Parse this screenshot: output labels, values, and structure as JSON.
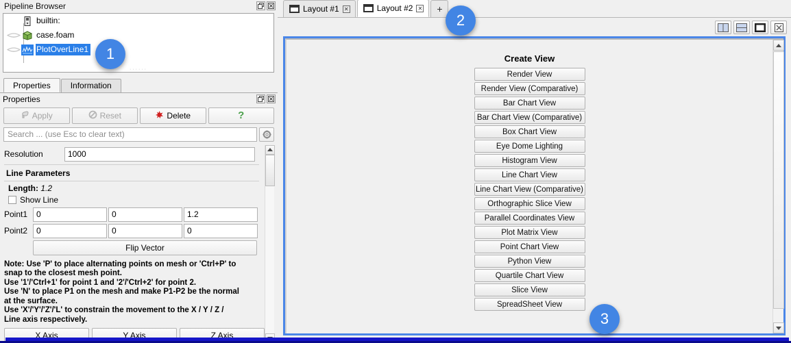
{
  "pipeline": {
    "title": "Pipeline Browser",
    "float_icon": "restore-icon",
    "close_icon": "close-icon",
    "items": [
      {
        "label": "builtin:",
        "icon": "server-icon",
        "selected": false,
        "has_eye": false
      },
      {
        "label": "case.foam",
        "icon": "geometry-box-icon",
        "selected": false,
        "has_eye": true
      },
      {
        "label": "PlotOverLine1",
        "icon": "plot-over-line-icon",
        "selected": true,
        "has_eye": true
      }
    ]
  },
  "properties": {
    "tabs": [
      {
        "label": "Properties",
        "active": true
      },
      {
        "label": "Information",
        "active": false
      }
    ],
    "panel_title": "Properties",
    "actions": [
      {
        "label": "Apply",
        "icon": "apply-icon",
        "disabled": true
      },
      {
        "label": "Reset",
        "icon": "reset-icon",
        "disabled": true
      },
      {
        "label": "Delete",
        "icon": "delete-icon",
        "disabled": false
      },
      {
        "label": "?",
        "icon": "help-icon",
        "disabled": false
      }
    ],
    "search": {
      "placeholder": "Search ... (use Esc to clear text)",
      "value": "",
      "gear_icon": "gear-icon"
    },
    "resolution": {
      "label": "Resolution",
      "value": "1000"
    },
    "line_parameters_title": "Line Parameters",
    "length": {
      "label": "Length:",
      "value": "1.2"
    },
    "show_line": {
      "label": "Show Line",
      "checked": false
    },
    "point1": {
      "label": "Point1",
      "x": "0",
      "y": "0",
      "z": "1.2"
    },
    "point2": {
      "label": "Point2",
      "x": "0",
      "y": "0",
      "z": "0"
    },
    "flip_vector_label": "Flip Vector",
    "note_lines": [
      "Note: Use 'P' to place alternating points on mesh or 'Ctrl+P' to",
      "snap to the closest mesh point.",
      "Use '1'/'Ctrl+1' for point 1 and '2'/'Ctrl+2' for point 2.",
      "Use 'N' to place P1 on the mesh and make P1-P2 be the normal",
      "at the surface.",
      "Use 'X'/'Y'/'Z'/'L' to constrain the movement to the X / Y / Z /",
      "Line axis respectively."
    ],
    "axis_buttons": [
      "X Axis",
      "Y Axis",
      "Z Axis"
    ]
  },
  "layout": {
    "tabs": [
      {
        "label": "Layout #1",
        "active": false,
        "icon": "layout-icon",
        "close_icon": "close-icon"
      },
      {
        "label": "Layout #2",
        "active": true,
        "icon": "layout-icon",
        "close_icon": "close-icon"
      }
    ],
    "new_tab_label": "+",
    "view_toolbar": [
      {
        "name": "split-horizontal-icon"
      },
      {
        "name": "split-vertical-icon"
      },
      {
        "name": "maximize-view-icon"
      },
      {
        "name": "close-view-icon"
      }
    ]
  },
  "create_view": {
    "title": "Create View",
    "buttons": [
      "Render View",
      "Render View (Comparative)",
      "Bar Chart View",
      "Bar Chart View (Comparative)",
      "Box Chart View",
      "Eye Dome Lighting",
      "Histogram View",
      "Line Chart View",
      "Line Chart View (Comparative)",
      "Orthographic Slice View",
      "Parallel Coordinates View",
      "Plot Matrix View",
      "Point Chart View",
      "Python View",
      "Quartile Chart View",
      "Slice View",
      "SpreadSheet View"
    ]
  },
  "badges": [
    {
      "number": "1"
    },
    {
      "number": "2"
    },
    {
      "number": "3"
    }
  ],
  "colors": {
    "accent_blue": "#4285e4",
    "active_view_border": "#4a86e8",
    "selection_blue": "#2a7fe8",
    "status_bar": "#1515c8"
  }
}
